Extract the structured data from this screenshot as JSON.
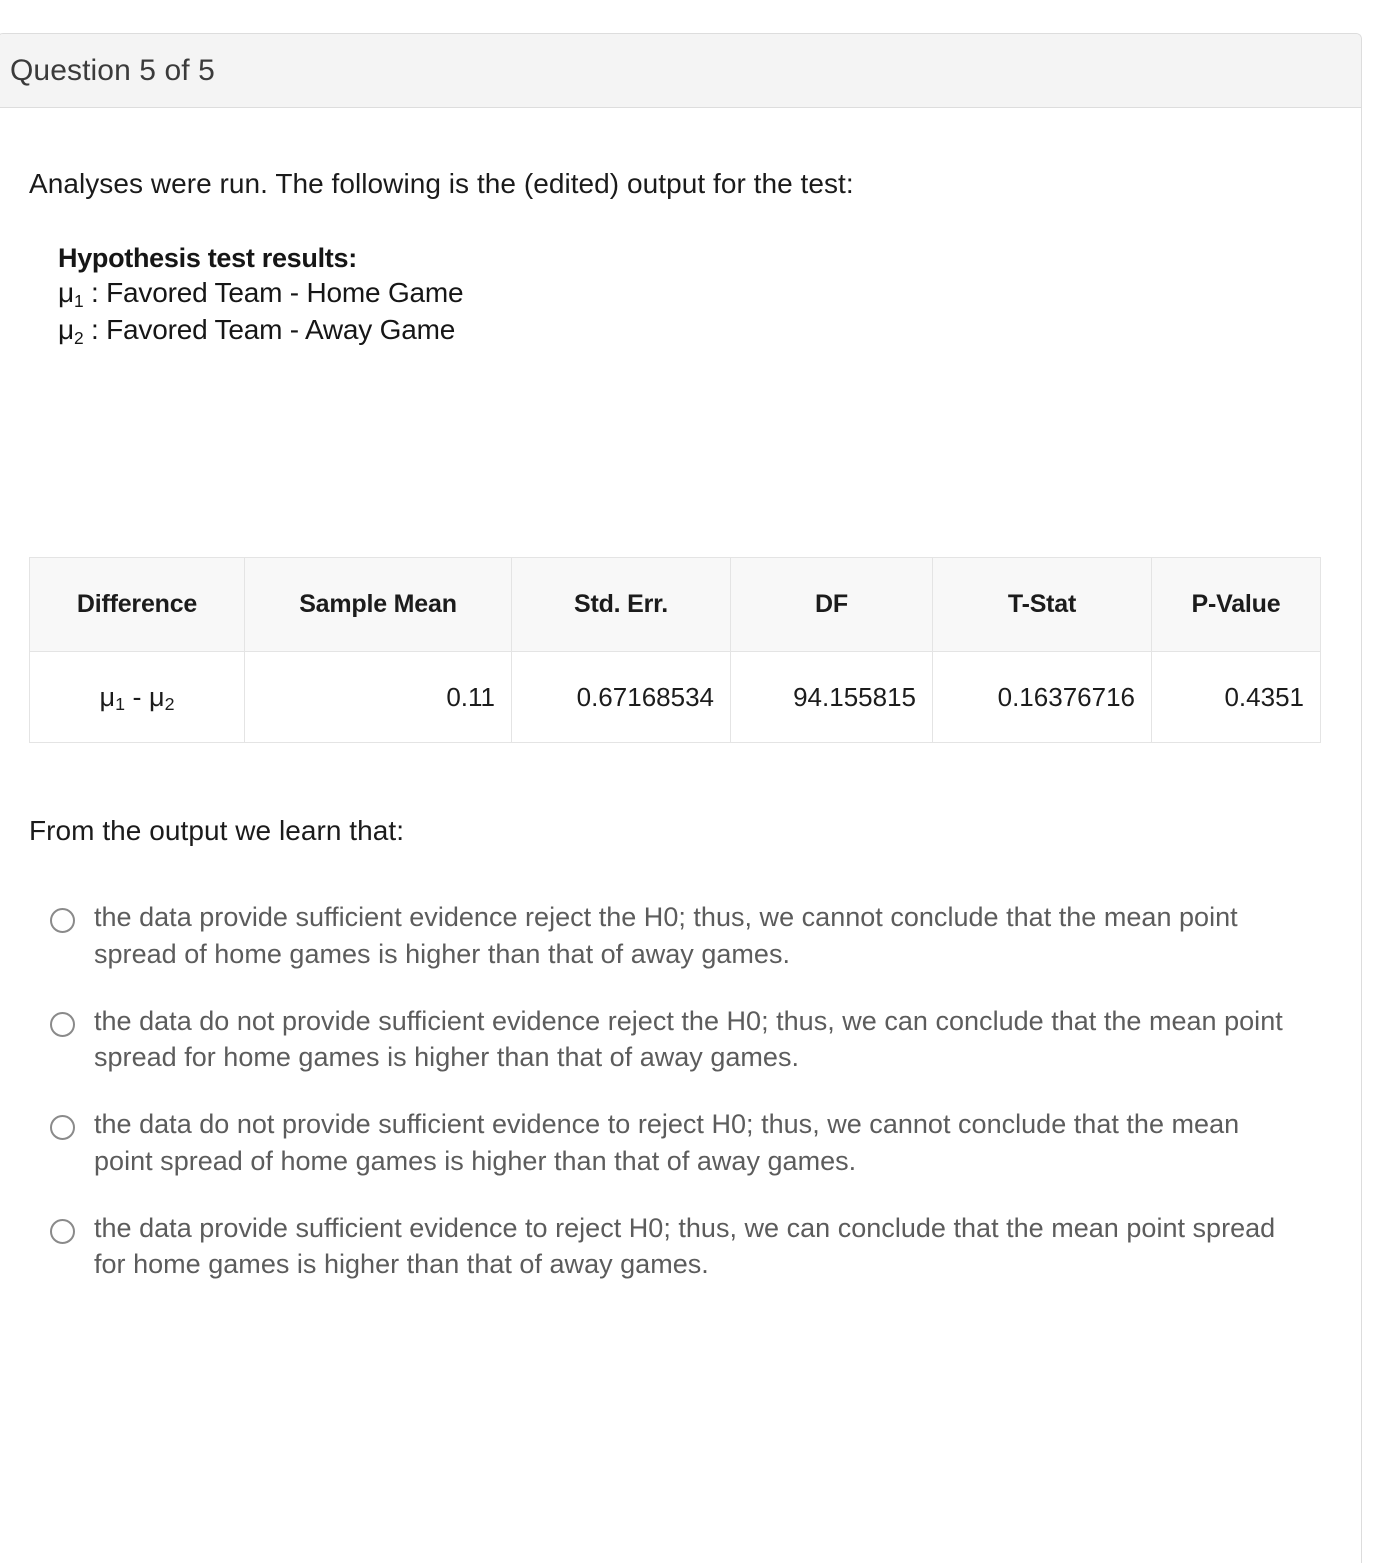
{
  "header": {
    "title": "Question 5 of 5"
  },
  "prompt": "Analyses were run. The following is the (edited) output for the test:",
  "output": {
    "title": "Hypothesis test results:",
    "mu1_symbol": "μ",
    "mu1_sub": "1",
    "mu1_text": " : Favored Team - Home Game",
    "mu2_symbol": "μ",
    "mu2_sub": "2",
    "mu2_text": " : Favored Team - Away Game"
  },
  "table": {
    "headers": [
      "Difference",
      "Sample Mean",
      "Std. Err.",
      "DF",
      "T-Stat",
      "P-Value"
    ],
    "row": {
      "difference_mu1": "μ",
      "difference_sub1": "1",
      "difference_minus": " - ",
      "difference_mu2": "μ",
      "difference_sub2": "2",
      "sample_mean": "0.11",
      "std_err": "0.67168534",
      "df": "94.155815",
      "t_stat": "0.16376716",
      "p_value": "0.4351"
    }
  },
  "learn_line": "From the output we learn that:",
  "options": [
    {
      "label": "the data provide sufficient evidence reject the H0; thus, we cannot conclude that the mean point spread of home games is higher than that of away games."
    },
    {
      "label": "the data do not provide sufficient evidence reject the H0; thus, we can conclude that the mean point spread for home games is higher than that of away games."
    },
    {
      "label": "the data do not provide sufficient evidence to reject H0; thus, we cannot conclude that the mean point spread of home games is higher than that of away games."
    },
    {
      "label": "the data provide sufficient evidence to reject H0; thus, we can conclude that the mean point spread for home games is higher than that of away games."
    }
  ],
  "colors": {
    "header_background": "#f4f4f4",
    "card_border": "#dddddd",
    "table_header_background": "#f8f8f8",
    "table_border": "#e4e4e4",
    "option_text": "#5c5c5c",
    "radio_border": "#8a8a8a"
  }
}
